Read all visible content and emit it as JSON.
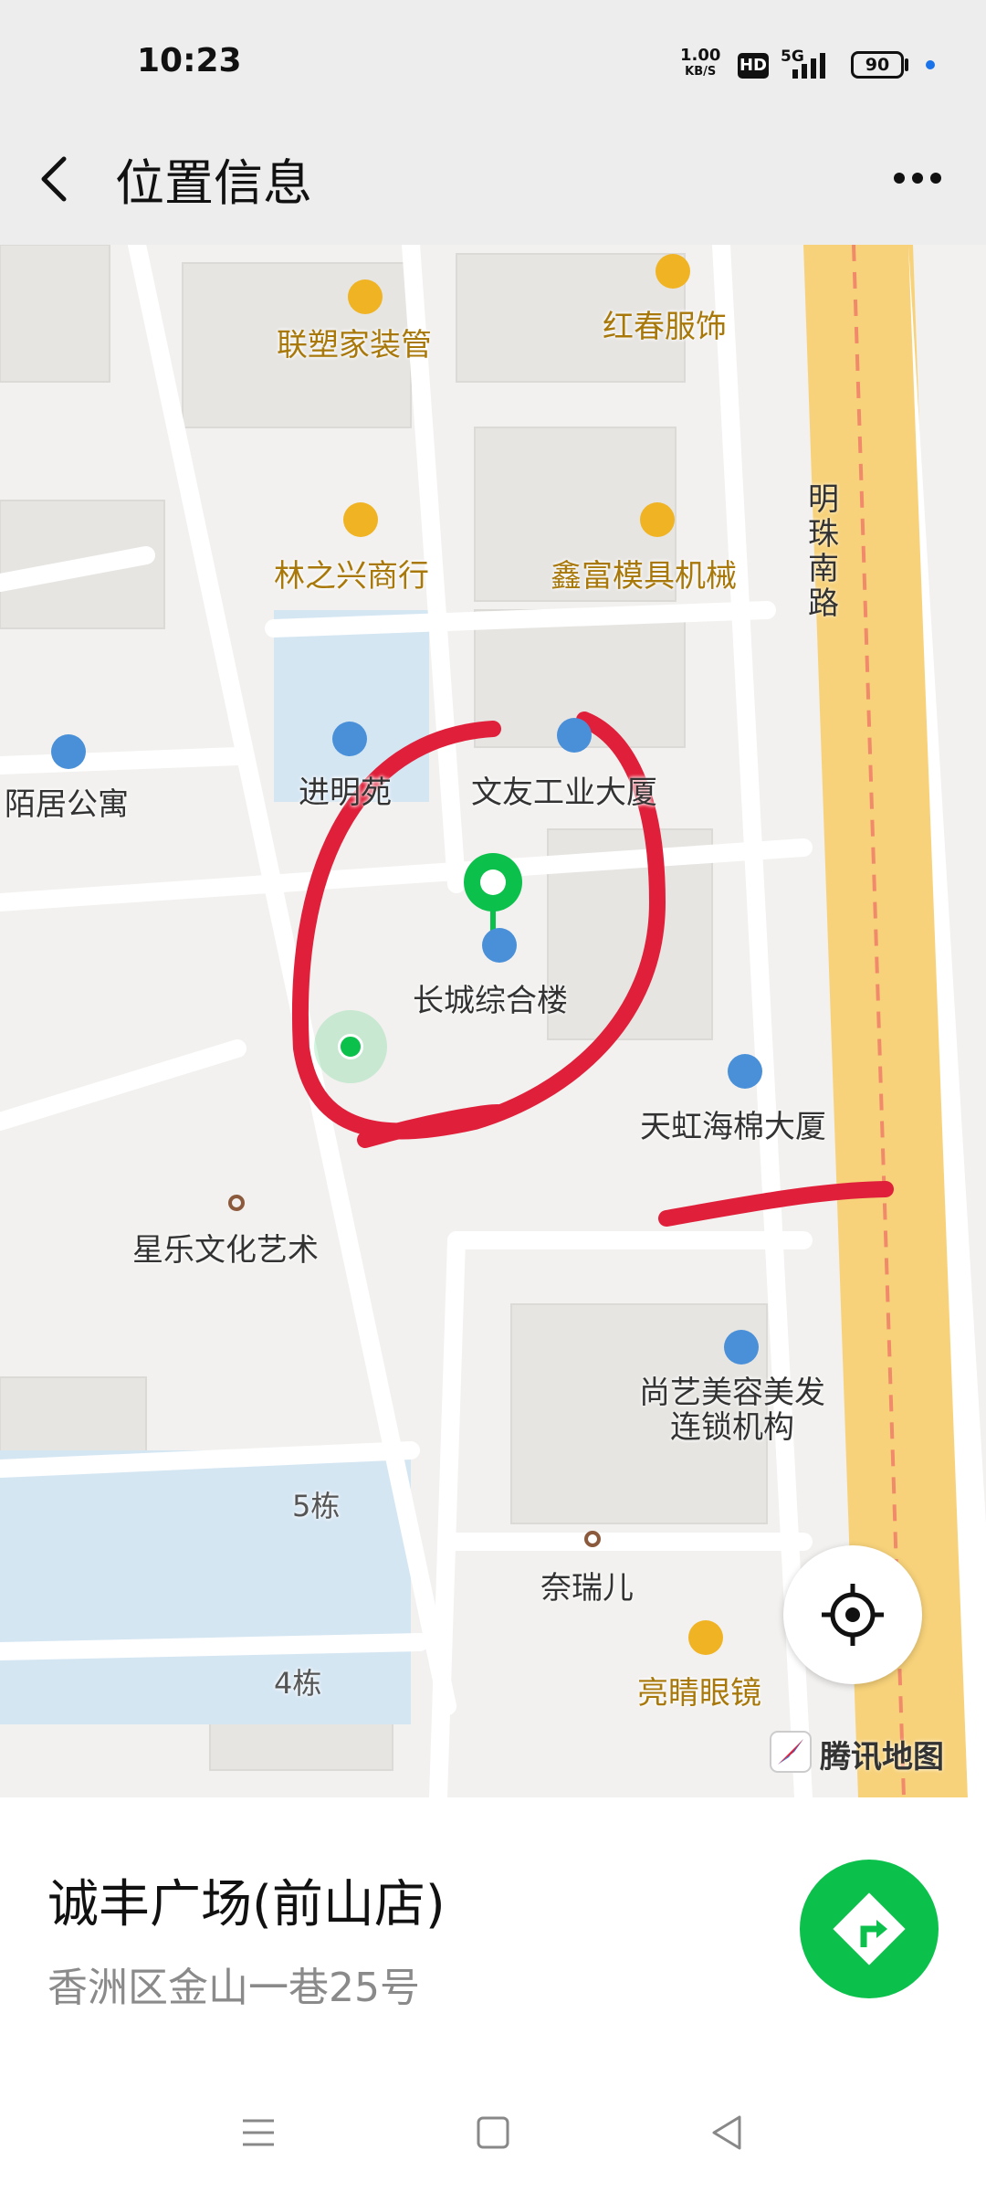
{
  "status_bar": {
    "time": "10:23",
    "net_speed_value": "1.00",
    "net_speed_unit": "KB/S",
    "hd_badge": "HD",
    "network_type": "5G",
    "battery": "90"
  },
  "header": {
    "title": "位置信息",
    "back_icon": "chevron-left-icon",
    "more_icon": "more-horizontal-icon"
  },
  "map": {
    "road_label": "明珠南路",
    "pois": [
      {
        "name": "联塑家装管",
        "icon": "shop-icon"
      },
      {
        "name": "红春服饰",
        "icon": "shop-icon"
      },
      {
        "name": "林之兴商行",
        "icon": "shop-icon"
      },
      {
        "name": "鑫富模具机械",
        "icon": "shop-icon"
      },
      {
        "name": "陌居公寓",
        "icon": "hotel-icon"
      },
      {
        "name": "进明苑",
        "icon": "home-icon"
      },
      {
        "name": "文友工业大厦",
        "icon": "building-icon"
      },
      {
        "name": "长城综合楼",
        "icon": "building-icon"
      },
      {
        "name": "天虹海棉大厦",
        "icon": "building-icon"
      },
      {
        "name": "星乐文化艺术",
        "icon": "dot-icon"
      },
      {
        "name": "尚艺美容美发\n连锁机构",
        "icon": "scissors-icon"
      },
      {
        "name": "5栋",
        "icon": ""
      },
      {
        "name": "奈瑞儿",
        "icon": "dot-icon"
      },
      {
        "name": "4栋",
        "icon": ""
      },
      {
        "name": "亮睛眼镜",
        "icon": "shop-icon"
      }
    ],
    "logo_text": "腾讯地图",
    "locate_icon": "crosshair-icon",
    "colors": {
      "accent_green": "#0cc04c",
      "road_yellow": "#f7d27a",
      "poi_orange": "#a8780a",
      "annotation_red": "#e0203a"
    }
  },
  "place": {
    "name": "诚丰广场(前山店)",
    "address": "香洲区金山一巷25号",
    "navigate_icon": "navigate-arrow-icon"
  },
  "system_nav": {
    "menu_icon": "menu-icon",
    "home_icon": "square-home-icon",
    "back_icon": "triangle-back-icon"
  }
}
